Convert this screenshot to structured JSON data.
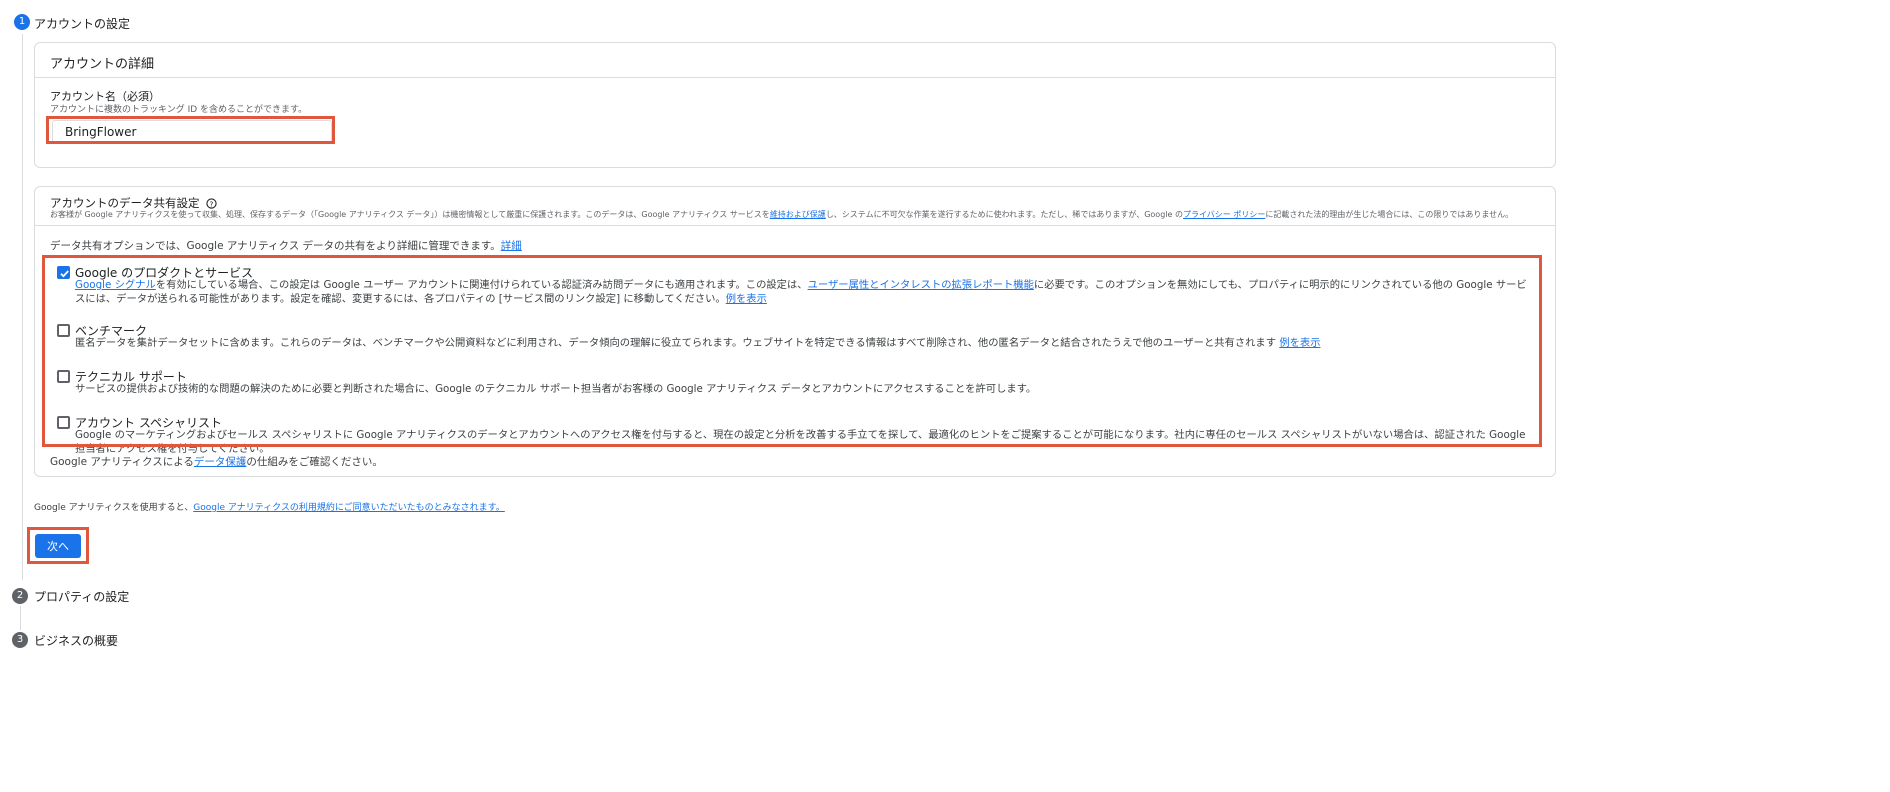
{
  "steps": [
    {
      "number": "1",
      "label": "アカウントの設定"
    },
    {
      "number": "2",
      "label": "プロパティの設定"
    },
    {
      "number": "3",
      "label": "ビジネスの概要"
    }
  ],
  "account_details": {
    "title": "アカウントの詳細",
    "name_label": "アカウント名（必須）",
    "name_hint": "アカウントに複数のトラッキング ID を含めることができます。",
    "name_value": "BringFlower"
  },
  "data_sharing": {
    "title": "アカウントのデータ共有設定",
    "description_prefix": "お客様が Google アナリティクスを使って収集、処理、保存するデータ（「Google アナリティクス データ」）は機密情報として厳重に保護されます。このデータは、Google アナリティクス サービスを",
    "description_link1": "維持および保護",
    "description_mid": "し、システムに不可欠な作業を遂行するために使われます。ただし、稀ではありますが、Google の",
    "description_link2": "プライバシー ポリシー",
    "description_suffix": "に記載された法的理由が生じた場合には、この限りではありません。",
    "intro_text": "データ共有オプションでは、Google アナリティクス データの共有をより詳細に管理できます。",
    "intro_link": "詳細",
    "options": [
      {
        "title": "Google のプロダクトとサービス",
        "checked": true,
        "desc_link1": "Google シグナル",
        "desc_part1": "を有効にしている場合、この設定は Google ユーザー アカウントに関連付けられている認証済み訪問データにも適用されます。この設定は、",
        "desc_link2": "ユーザー属性とインタレストの拡張レポート機能",
        "desc_part2": "に必要です。このオプションを無効にしても、プロパティに明示的にリンクされている他の Google サービスには、データが送られる可能性があります。設定を確認、変更するには、各プロパティの [サービス間のリンク設定] に移動してください。",
        "desc_link3": "例を表示"
      },
      {
        "title": "ベンチマーク",
        "checked": false,
        "desc": "匿名データを集計データセットに含めます。これらのデータは、ベンチマークや公開資料などに利用され、データ傾向の理解に役立てられます。ウェブサイトを特定できる情報はすべて削除され、他の匿名データと結合されたうえで他のユーザーと共有されます",
        "desc_link": "例を表示"
      },
      {
        "title": "テクニカル サポート",
        "checked": false,
        "desc": "サービスの提供および技術的な問題の解決のために必要と判断された場合に、Google のテクニカル サポート担当者がお客様の Google アナリティクス データとアカウントにアクセスすることを許可します。"
      },
      {
        "title": "アカウント スペシャリスト",
        "checked": false,
        "desc": "Google のマーケティングおよびセールス スペシャリストに Google アナリティクスのデータとアカウントへのアクセス権を付与すると、現在の設定と分析を改善する手立てを探して、最適化のヒントをご提案することが可能になります。社内に専任のセールス スペシャリストがいない場合は、認証された Google 担当者にアクセス権を付与してください。"
      }
    ],
    "footer_prefix": "Google アナリティクスによる",
    "footer_link": "データ保護",
    "footer_suffix": "の仕組みをご確認ください。"
  },
  "terms": {
    "prefix": "Google アナリティクスを使用すると、",
    "link": "Google アナリティクスの利用規約にご同意いただいたものとみなされます。"
  },
  "next_button": "次へ",
  "colors": {
    "accent": "#1a73e8",
    "highlight": "#e0573d",
    "inactive_step": "#5f6368"
  }
}
